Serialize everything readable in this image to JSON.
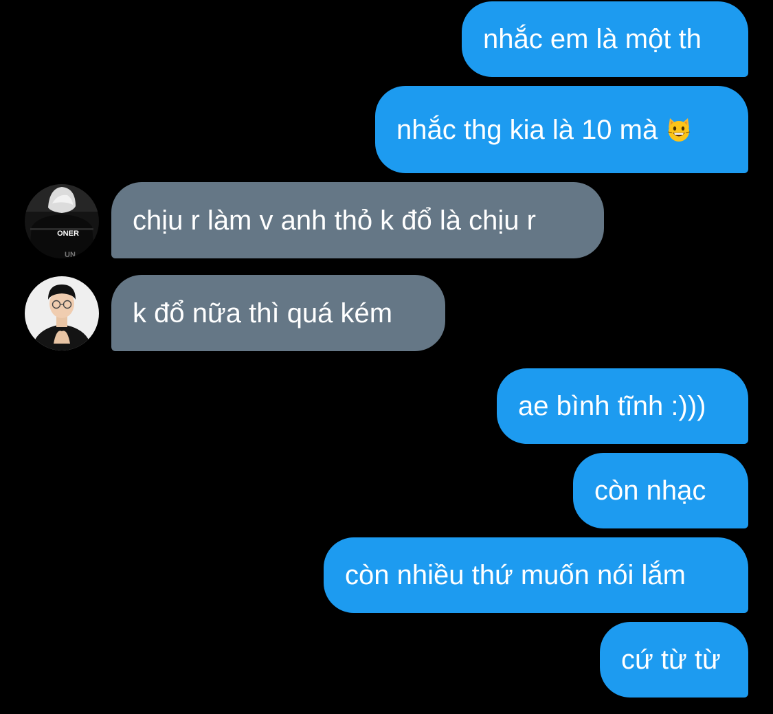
{
  "conversation": {
    "messages": [
      {
        "sender": "me",
        "text": "nhắc em là một th"
      },
      {
        "sender": "me",
        "text": "nhắc thg kia là 10 mà",
        "emoji": "grinning-cat-emoji"
      },
      {
        "sender": "other",
        "text": "chịu r làm v anh thỏ k đổ là chịu r",
        "avatar": {
          "icon": "avatar-player-jersey-icon",
          "jersey_text": "ONER",
          "jersey_subtext": "UN"
        }
      },
      {
        "sender": "other",
        "text": "k đổ nữa thì quá kém",
        "avatar": {
          "icon": "avatar-person-glasses-icon"
        }
      },
      {
        "sender": "me",
        "text": "ae bình tĩnh :)))"
      },
      {
        "sender": "me",
        "text": "còn nhạc"
      },
      {
        "sender": "me",
        "text": "còn nhiều thứ muốn nói lắm"
      },
      {
        "sender": "me",
        "text": "cứ từ từ"
      }
    ]
  },
  "colors": {
    "background": "#000000",
    "sent_bubble": "#1d9bf0",
    "received_bubble": "#657786",
    "text": "#ffffff"
  }
}
